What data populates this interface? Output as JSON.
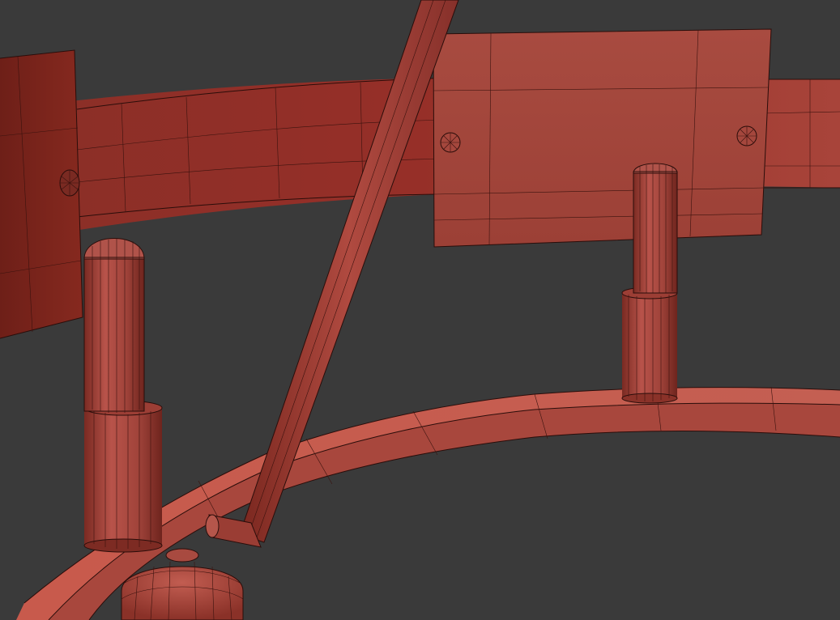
{
  "scene": {
    "background": "#3a3a3a",
    "mesh_color": "#a94a3f",
    "mesh_dark": "#6e2721",
    "mesh_light": "#c25a4b",
    "wire_color": "#2a0d0a",
    "render_style": "wireframe-on-shaded",
    "objects": [
      "back-ring-band",
      "front-ring-band",
      "left-panel",
      "right-panel",
      "left-post",
      "right-post",
      "diagonal-rod",
      "rod-foot",
      "bottom-cap",
      "screw-heads"
    ]
  }
}
